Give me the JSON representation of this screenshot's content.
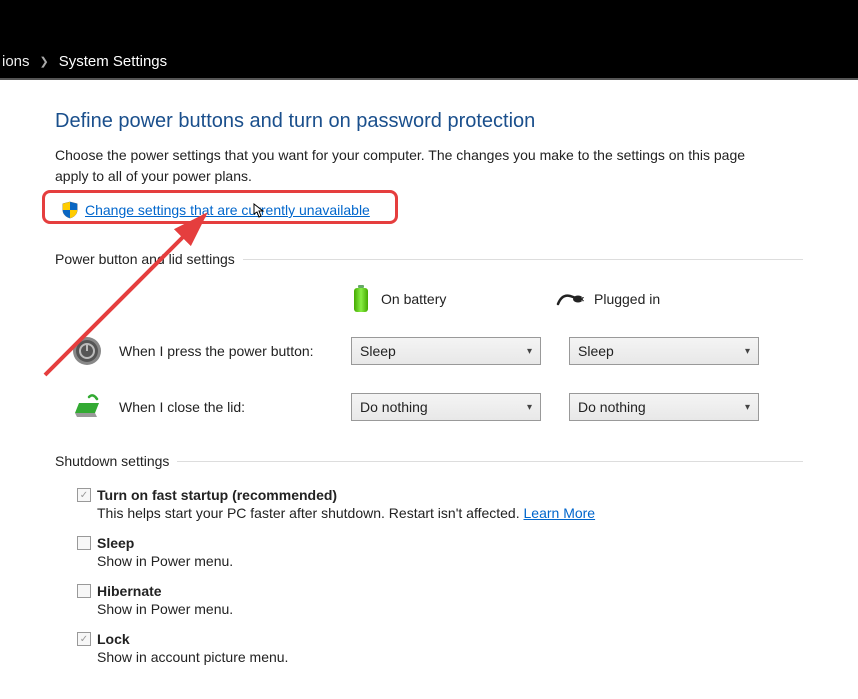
{
  "breadcrumb": {
    "truncated": "ions",
    "current": "System Settings"
  },
  "title": "Define power buttons and turn on password protection",
  "description": "Choose the power settings that you want for your computer. The changes you make to the settings on this page apply to all of your power plans.",
  "change_link": "Change settings that are currently unavailable",
  "section_buttons": "Power button and lid settings",
  "col_battery": "On battery",
  "col_plugged": "Plugged in",
  "rows": [
    {
      "label": "When I press the power button:",
      "battery": "Sleep",
      "plugged": "Sleep"
    },
    {
      "label": "When I close the lid:",
      "battery": "Do nothing",
      "plugged": "Do nothing"
    }
  ],
  "section_shutdown": "Shutdown settings",
  "shutdown": [
    {
      "label": "Turn on fast startup (recommended)",
      "desc": "This helps start your PC faster after shutdown. Restart isn't affected. ",
      "link": "Learn More",
      "checked": true
    },
    {
      "label": "Sleep",
      "desc": "Show in Power menu.",
      "checked": false
    },
    {
      "label": "Hibernate",
      "desc": "Show in Power menu.",
      "checked": false
    },
    {
      "label": "Lock",
      "desc": "Show in account picture menu.",
      "checked": true
    }
  ]
}
